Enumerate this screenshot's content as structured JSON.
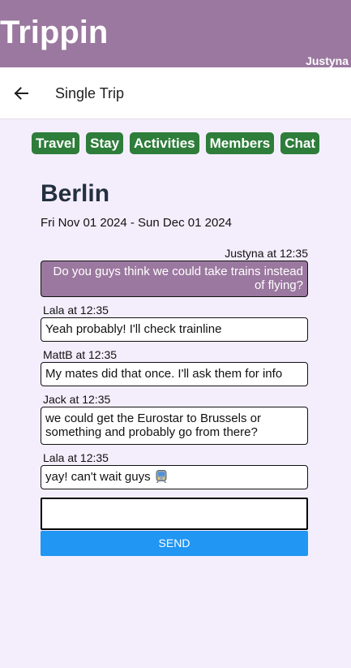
{
  "app": {
    "title": "Trippin",
    "user": "Justyna"
  },
  "nav": {
    "back_icon": "arrow-left-icon",
    "title": "Single Trip"
  },
  "tabs": [
    {
      "label": "Travel"
    },
    {
      "label": "Stay"
    },
    {
      "label": "Activities"
    },
    {
      "label": "Members"
    },
    {
      "label": "Chat"
    }
  ],
  "trip": {
    "name": "Berlin",
    "dates": "Fri Nov 01 2024 - Sun Dec 01 2024"
  },
  "messages": [
    {
      "meta": "Justyna at 12:35",
      "text": "Do you guys think we could take trains instead of flying?",
      "own": true
    },
    {
      "meta": "Lala at 12:35",
      "text": "Yeah probably! I'll check trainline",
      "own": false
    },
    {
      "meta": "MattB at 12:35",
      "text": "My mates did that once. I'll ask them for info",
      "own": false
    },
    {
      "meta": "Jack at 12:35",
      "text": "we could get the Eurostar to Brussels or something and probably go from there?",
      "own": false
    },
    {
      "meta": "Lala at 12:35",
      "text": "yay! can't wait guys",
      "own": false,
      "icon": "train-emoji-icon"
    }
  ],
  "composer": {
    "value": "",
    "placeholder": "",
    "send_label": "SEND"
  },
  "colors": {
    "header": "#9b789f",
    "tab": "#2e7d3a",
    "send": "#2196f3",
    "background": "#f4eefc"
  }
}
